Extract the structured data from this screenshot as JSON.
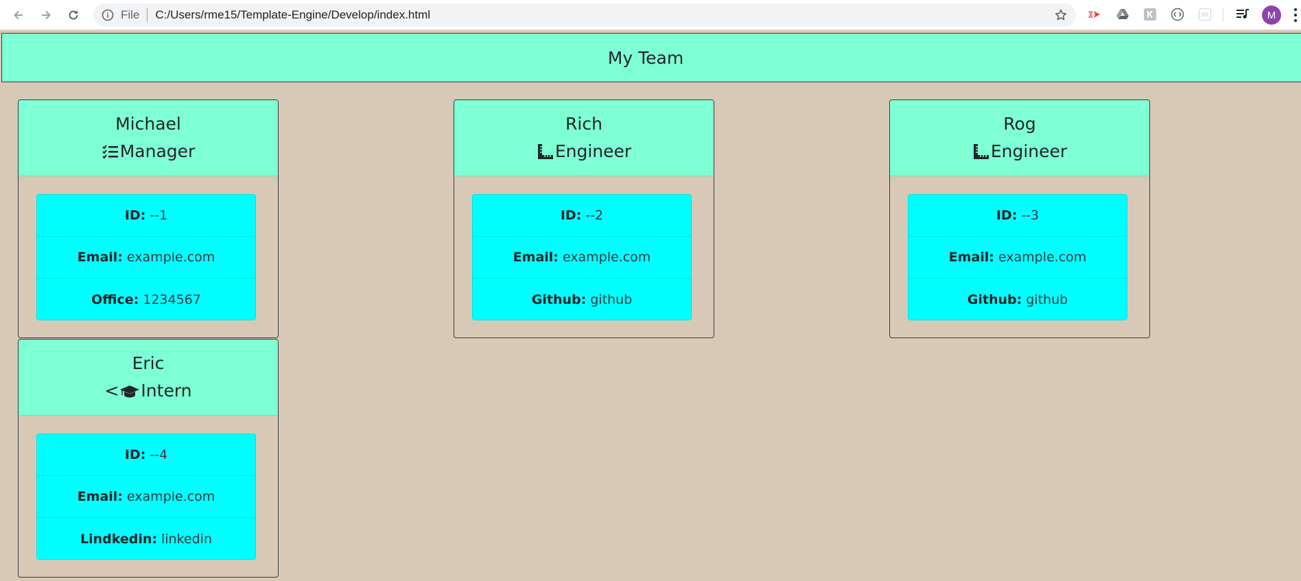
{
  "browser": {
    "scheme": "File",
    "url": "C:/Users/rme15/Template-Engine/Develop/index.html",
    "avatar_letter": "M"
  },
  "page": {
    "title": "My Team",
    "colors": {
      "header": "#7fffd4",
      "list": "#00ffff",
      "background": "#d8c9b7"
    }
  },
  "team": [
    {
      "name": "Michael",
      "role": "Manager",
      "role_prefix": "",
      "icon": "tasks-icon",
      "fields": [
        {
          "label": "ID:",
          "value": "--1"
        },
        {
          "label": "Email:",
          "value": "example.com"
        },
        {
          "label": "Office:",
          "value": "1234567"
        }
      ]
    },
    {
      "name": "Rich",
      "role": "Engineer",
      "role_prefix": "",
      "icon": "ruler-combined-icon",
      "fields": [
        {
          "label": "ID:",
          "value": "--2"
        },
        {
          "label": "Email:",
          "value": "example.com"
        },
        {
          "label": "Github:",
          "value": "github"
        }
      ]
    },
    {
      "name": "Rog",
      "role": "Engineer",
      "role_prefix": "",
      "icon": "ruler-combined-icon",
      "fields": [
        {
          "label": "ID:",
          "value": "--3"
        },
        {
          "label": "Email:",
          "value": "example.com"
        },
        {
          "label": "Github:",
          "value": "github"
        }
      ]
    },
    {
      "name": "Eric",
      "role": "Intern",
      "role_prefix": "<",
      "icon": "graduation-cap-icon",
      "fields": [
        {
          "label": "ID:",
          "value": "--4"
        },
        {
          "label": "Email:",
          "value": "example.com"
        },
        {
          "label": "Lindkedin:",
          "value": "linkedin"
        }
      ]
    }
  ]
}
